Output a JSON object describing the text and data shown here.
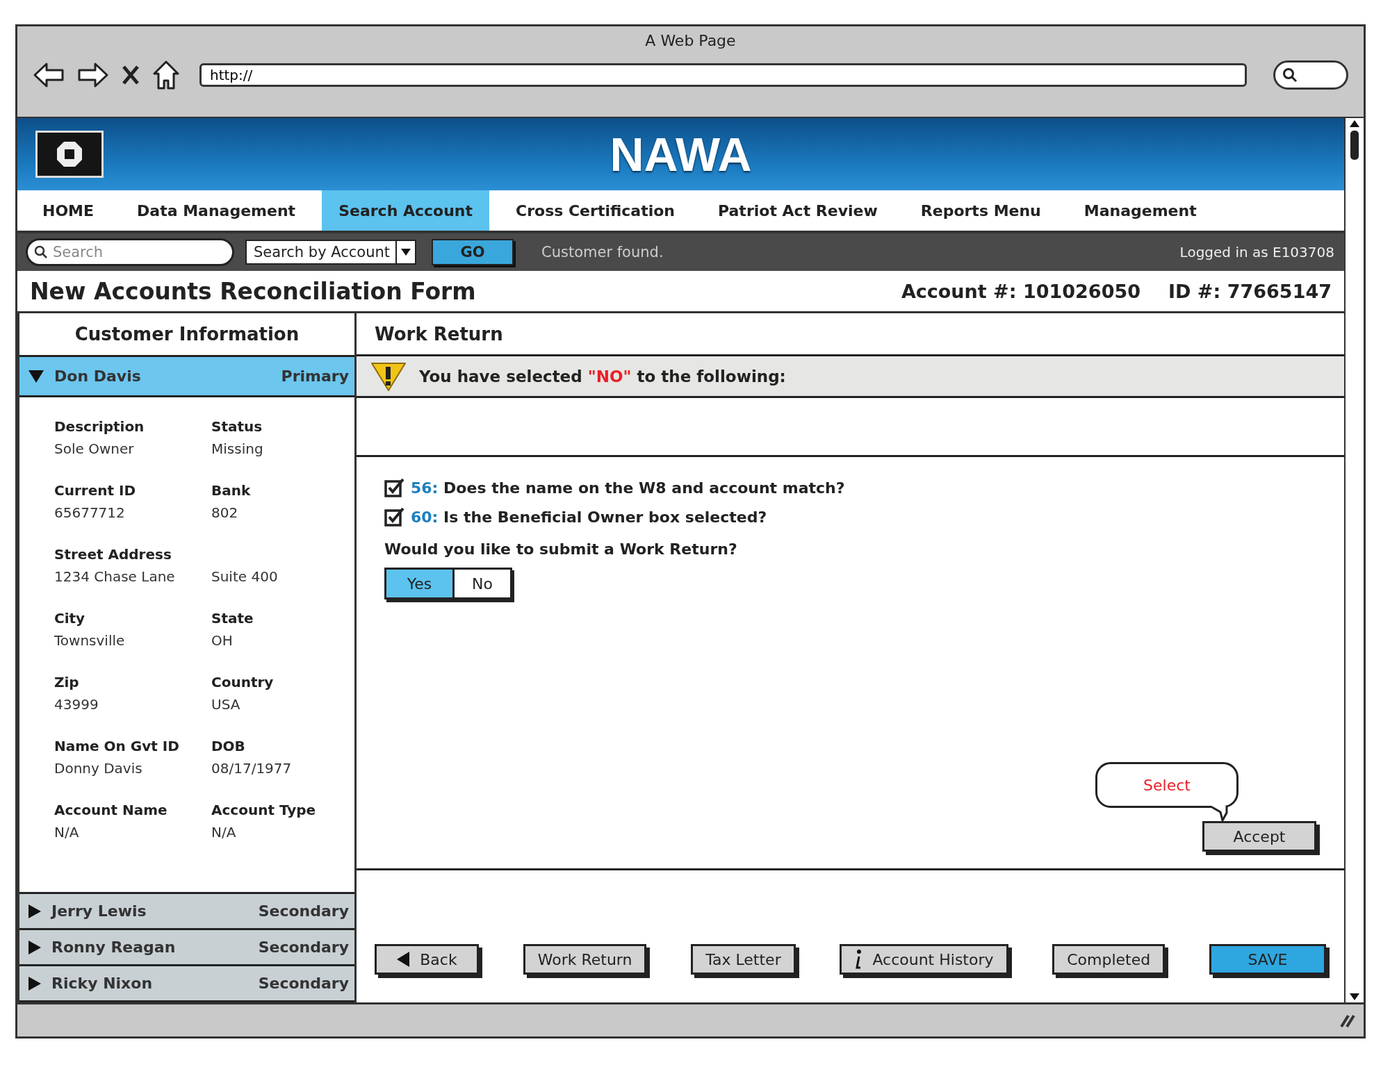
{
  "browser": {
    "title": "A Web Page",
    "url": "http://"
  },
  "header": {
    "title": "NAWA"
  },
  "nav": [
    {
      "label": "HOME",
      "selected": false
    },
    {
      "label": "Data Management",
      "selected": false
    },
    {
      "label": "Search Account",
      "selected": true
    },
    {
      "label": "Cross Certification",
      "selected": false
    },
    {
      "label": "Patriot Act Review",
      "selected": false
    },
    {
      "label": "Reports Menu",
      "selected": false
    },
    {
      "label": "Management",
      "selected": false
    }
  ],
  "toolbar": {
    "search": {
      "placeholder": "Search"
    },
    "search_type": "Search by Account",
    "go_button": "GO",
    "status": "Customer found.",
    "logged_in": "Logged in as E103708"
  },
  "form": {
    "title": "New Accounts Reconciliation Form",
    "account": "Account #: 101026050",
    "id": "ID #: 77665147"
  },
  "customer_panel": {
    "title": "Customer Information",
    "customers": [
      {
        "name": "Don Davis",
        "role": "Primary",
        "expanded": true,
        "fields": [
          {
            "label": "Description",
            "value": "Sole Owner"
          },
          {
            "label": "Status",
            "value": "Missing"
          },
          {
            "label": "Current ID",
            "value": "65677712"
          },
          {
            "label": "Bank",
            "value": "802"
          },
          {
            "label": "Street Address",
            "value": "1234 Chase Lane"
          },
          {
            "value": "Suite 400"
          },
          {
            "label": "City",
            "value": "Townsville"
          },
          {
            "label": "State",
            "value": "OH"
          },
          {
            "label": "Zip",
            "value": "43999"
          },
          {
            "label": "Country",
            "value": "USA"
          },
          {
            "label": "Name On Gvt ID",
            "value": "Donny Davis"
          },
          {
            "label": "DOB",
            "value": "08/17/1977"
          },
          {
            "label": "Account Name",
            "value": "N/A"
          },
          {
            "label": "Account Type",
            "value": "N/A"
          }
        ]
      },
      {
        "name": "Jerry Lewis",
        "role": "Secondary",
        "expanded": false
      },
      {
        "name": "Ronny Reagan",
        "role": "Secondary",
        "expanded": false
      },
      {
        "name": "Ricky Nixon",
        "role": "Secondary",
        "expanded": false
      }
    ]
  },
  "work_return": {
    "title": "Work Return",
    "warning": {
      "before": "You have selected ",
      "highlight": "\"NO\"",
      "after": " to the following:"
    },
    "questions": [
      {
        "number": "56:",
        "text": " Does the name on the W8 and account match?",
        "checked": true
      },
      {
        "number": "60:",
        "text": " Is the Beneficial Owner box selected?",
        "checked": true
      }
    ],
    "prompt": "Would you like to submit a Work Return?",
    "options": [
      {
        "label": "Yes",
        "selected": true
      },
      {
        "label": "No",
        "selected": false
      }
    ],
    "callout": "Select",
    "accept_button": "Accept",
    "buttons": [
      {
        "label": "Back",
        "kind": "back"
      },
      {
        "label": "Work Return",
        "kind": "plain"
      },
      {
        "label": "Tax Letter",
        "kind": "plain"
      },
      {
        "label": "Account History",
        "kind": "info"
      },
      {
        "label": "Completed",
        "kind": "plain"
      },
      {
        "label": "SAVE",
        "kind": "primary"
      }
    ]
  }
}
